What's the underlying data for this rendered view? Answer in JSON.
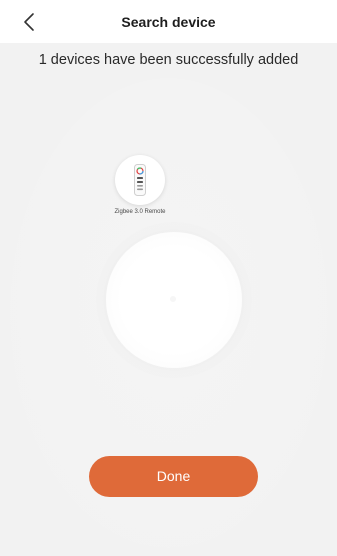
{
  "header": {
    "title": "Search device",
    "back_icon": "chevron-left-icon"
  },
  "status_text": "1 devices have been successfully added",
  "devices": [
    {
      "name": "Zigbee 3.0 Remote",
      "icon": "remote-control-icon"
    }
  ],
  "done_label": "Done",
  "colors": {
    "background": "#f2f2f2",
    "nav_background": "#ffffff",
    "accent": "#df6a39",
    "text": "#2a2a2a"
  }
}
